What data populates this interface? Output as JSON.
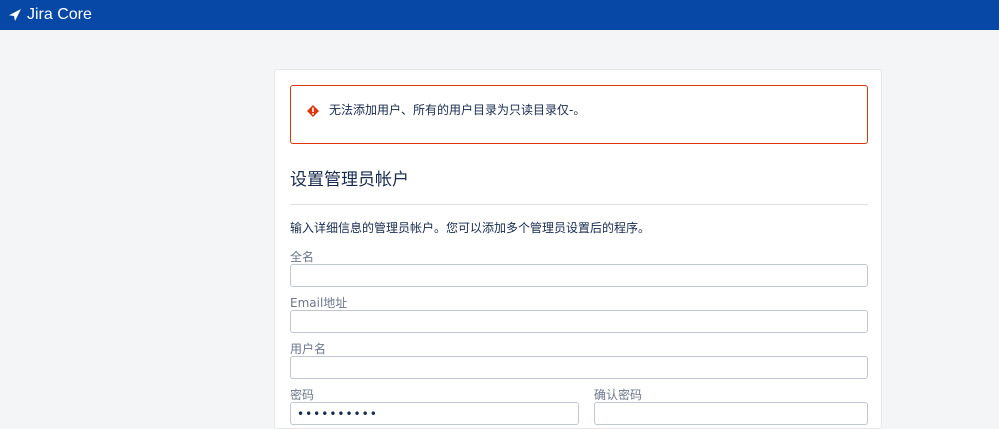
{
  "header": {
    "brand_icon": "jira-logo-icon",
    "product_name": "Jira Core",
    "bg_color": "#0747a6"
  },
  "alert": {
    "icon": "warning-icon",
    "message": "无法添加用户、所有的用户目录为只读目录仅-。",
    "border_color": "#de350b"
  },
  "form": {
    "title": "设置管理员帐户",
    "description": "输入详细信息的管理员帐户。您可以添加多个管理员设置后的程序。",
    "fullname": {
      "label": "全名",
      "value": ""
    },
    "email": {
      "label": "Email地址",
      "value": ""
    },
    "username": {
      "label": "用户名",
      "value": ""
    },
    "password": {
      "label": "密码",
      "value": "••••••••••"
    },
    "confirm_password": {
      "label": "确认密码",
      "value": ""
    }
  }
}
